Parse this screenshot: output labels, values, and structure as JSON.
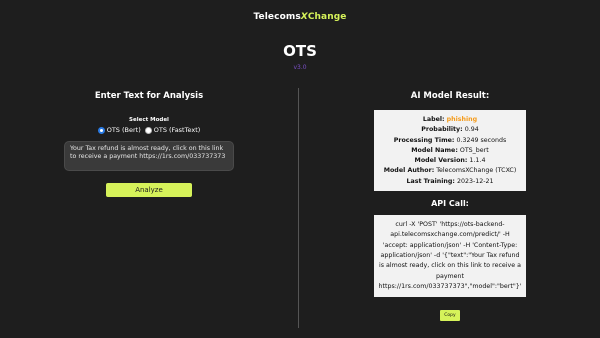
{
  "brand": {
    "part1": "Telecoms",
    "part2": "X",
    "part3": "Change"
  },
  "app": {
    "title": "OTS",
    "version": "v3.0"
  },
  "input_section": {
    "title": "Enter Text for Analysis",
    "select_label": "Select Model",
    "options": [
      {
        "label": "OTS (Bert)",
        "selected": true
      },
      {
        "label": "OTS (FastText)",
        "selected": false
      }
    ],
    "text_value": "Your Tax refund is almost ready, click on this link to receive a payment https://1rs.com/033737373",
    "analyze_label": "Analyze"
  },
  "result_section": {
    "title": "AI Model Result:",
    "label_key": "Label:",
    "label_value": "phishing",
    "probability_key": "Probability:",
    "probability_value": "0.94",
    "time_key": "Processing Time:",
    "time_value": "0.3249 seconds",
    "name_key": "Model Name:",
    "name_value": "OTS_bert",
    "version_key": "Model Version:",
    "version_value": "1.1.4",
    "author_key": "Model Author:",
    "author_value": "TelecomsXChange (TCXC)",
    "training_key": "Last Training:",
    "training_value": "2023-12-21"
  },
  "api_section": {
    "title": "API Call:",
    "curl": "curl -X 'POST' 'https://ots-backend-api.telecomsxchange.com/predict/' -H 'accept: application/json' -H 'Content-Type: application/json' -d '{\"text\":\"Your Tax refund is almost ready, click on this link to receive a payment https://1rs.com/033737373\",\"model\":\"bert\"}'",
    "copy_label": "Copy"
  },
  "colors": {
    "accent": "#d6f25a",
    "background": "#1e1e1e",
    "version": "#7b4fc9",
    "label_value": "#f59b1a",
    "radio_checked": "#2a7be4"
  }
}
